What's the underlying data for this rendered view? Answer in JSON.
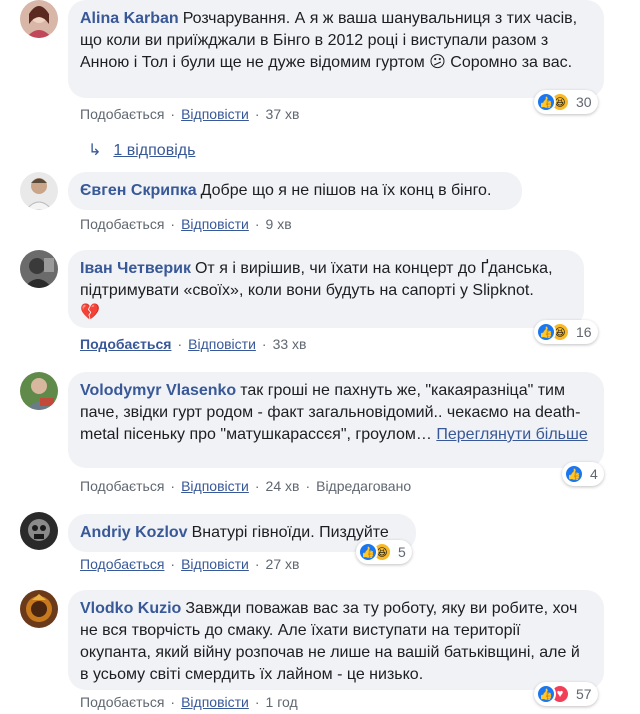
{
  "labels": {
    "like": "Подобається",
    "reply": "Відповісти",
    "edited": "Відредаговано",
    "see_more": "Переглянути більше"
  },
  "replies_link": "1 відповідь",
  "comments": [
    {
      "author": "Alina Karban",
      "text": "Розчарування. А я ж ваша шанувальниця з тих часів, що коли ви приїжджали в Бінго в 2012 році і виступали разом з Анною і Тол і були ще не дуже відомим гуртом 😕 Соромно за вас.",
      "time": "37 хв",
      "reactions": "30"
    },
    {
      "author": "Євген Скрипка",
      "text": "Добре що я не пішов на їх конц в бінго.",
      "time": "9 хв"
    },
    {
      "author": "Іван Четверик",
      "text": "От я і вирішив, чи їхати на концерт до Ґданська, підтримувати «своїх», коли вони будуть на сапорті у Slipknot.",
      "emoji": "💔",
      "time": "33 хв",
      "reactions": "16"
    },
    {
      "author": "Volodymyr Vlasenko",
      "text": "так гроші не пахнуть же, \"какаяразніца\" тим паче, звідки гурт родом - факт загальновідомий.. чекаємо на death-metal пісеньку про \"матушкарассєя\", гроулом…",
      "time": "24 хв",
      "reactions": "4"
    },
    {
      "author": "Andriy Kozlov",
      "text": "Внатурі гівноїди. Пиздуйте",
      "time": "27 хв",
      "reactions": "5"
    },
    {
      "author": "Vlodko Kuzio",
      "text": "Завжди поважав вас за ту роботу, яку ви робите, хоч не вся творчість до смаку. Але їхати виступати на території окупанта, який війну розпочав не лише на вашій батьківщині, але й в усьому світі смердить їх лайном - це низько.",
      "time": "1 год",
      "reactions": "57"
    }
  ]
}
